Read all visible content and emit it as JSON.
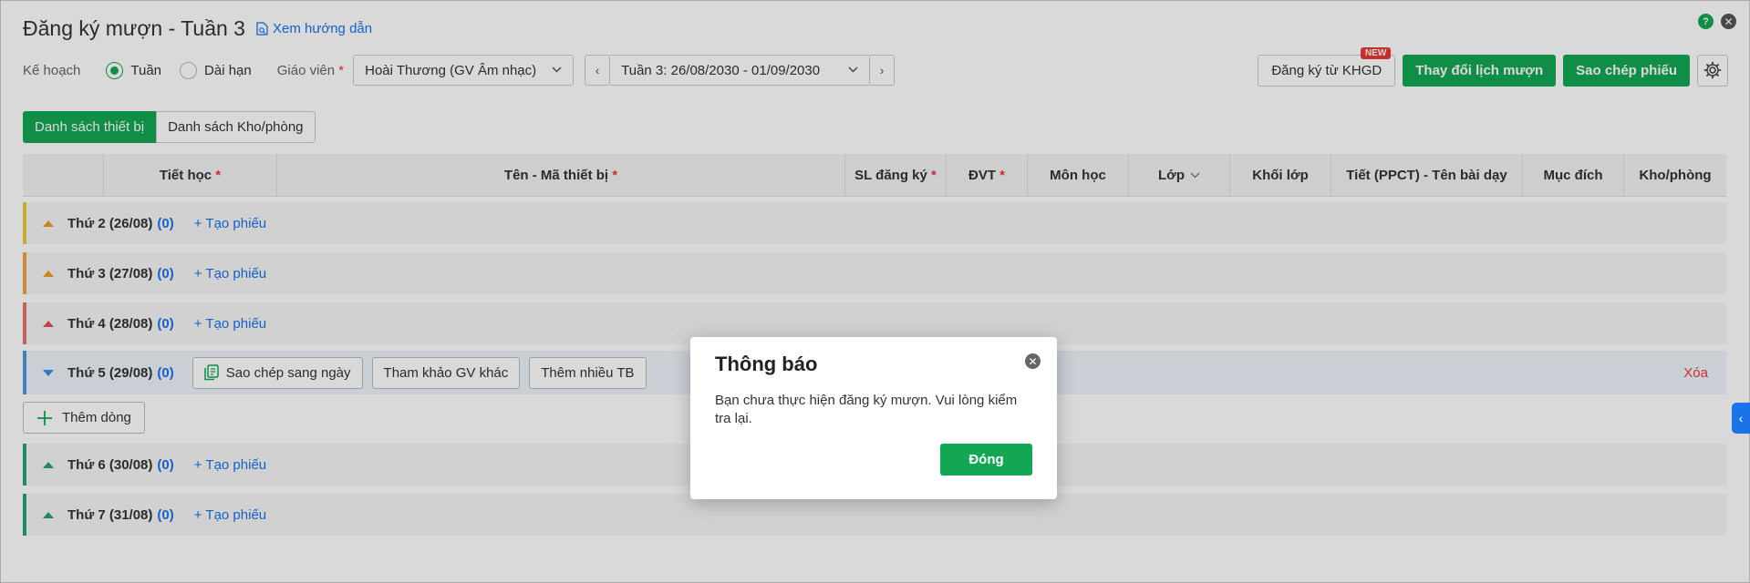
{
  "header": {
    "title": "Đăng ký mượn - Tuần 3",
    "guide_link": "Xem hướng dẫn",
    "help_glyph": "?",
    "close_glyph": "✕"
  },
  "filters": {
    "plan_label": "Kế hoạch",
    "radio_week": "Tuần",
    "radio_long": "Dài hạn",
    "selected_radio": "Tuần",
    "teacher_label": "Giáo viên",
    "required_mark": "*",
    "teacher_value": "Hoài Thương (GV Âm nhạc)",
    "week_value": "Tuần 3: 26/08/2030 - 01/09/2030",
    "prev_glyph": "‹",
    "next_glyph": "›",
    "chevron_glyph": "⌄"
  },
  "actions": {
    "register_khgd": "Đăng ký từ KHGD",
    "new_badge": "NEW",
    "change_schedule": "Thay đổi lịch mượn",
    "copy_form": "Sao chép phiếu"
  },
  "tabs": [
    {
      "label": "Danh sách thiết bị",
      "active": true
    },
    {
      "label": "Danh sách Kho/phòng",
      "active": false
    }
  ],
  "table": {
    "columns": [
      {
        "label": "",
        "required": false
      },
      {
        "label": "Tiết học",
        "required": true
      },
      {
        "label": "Tên - Mã thiết bị",
        "required": true
      },
      {
        "label": "SL đăng ký",
        "required": true
      },
      {
        "label": "ĐVT",
        "required": true
      },
      {
        "label": "Môn học",
        "required": false
      },
      {
        "label": "Lớp",
        "required": false,
        "sortable": true
      },
      {
        "label": "Khối lớp",
        "required": false
      },
      {
        "label": "Tiết (PPCT) - Tên bài dạy",
        "required": false
      },
      {
        "label": "Mục đích",
        "required": false
      },
      {
        "label": "Kho/phòng",
        "required": false
      }
    ],
    "days": [
      {
        "label": "Thứ 2 (26/08)",
        "count": "(0)",
        "color": "#e8c840",
        "expanded": false,
        "create": "+ Tạo phiếu"
      },
      {
        "label": "Thứ 3 (27/08)",
        "count": "(0)",
        "color": "#f0a040",
        "expanded": false,
        "create": "+ Tạo phiếu"
      },
      {
        "label": "Thứ 4 (28/08)",
        "count": "(0)",
        "color": "#e57373",
        "expanded": false,
        "create": "+ Tạo phiếu"
      },
      {
        "label": "Thứ 5 (29/08)",
        "count": "(0)",
        "color": "#4a9be0",
        "expanded": true,
        "buttons": [
          "Sao chép sang ngày",
          "Tham khảo GV khác",
          "Thêm nhiều TB"
        ],
        "delete": "Xóa"
      },
      {
        "label": "Thứ 6 (30/08)",
        "count": "(0)",
        "color": "#26a17b",
        "expanded": false,
        "create": "+ Tạo phiếu"
      },
      {
        "label": "Thứ 7 (31/08)",
        "count": "(0)",
        "color": "#26a17b",
        "expanded": false,
        "create": "+ Tạo phiếu"
      }
    ],
    "add_row": "Thêm dòng"
  },
  "modal": {
    "title": "Thông báo",
    "message": "Bạn chưa thực hiện đăng ký mượn. Vui lòng kiểm tra lại.",
    "ok": "Đóng"
  },
  "colors": {
    "accent": "#13a654",
    "link": "#1a73e8",
    "danger": "#e53935"
  }
}
